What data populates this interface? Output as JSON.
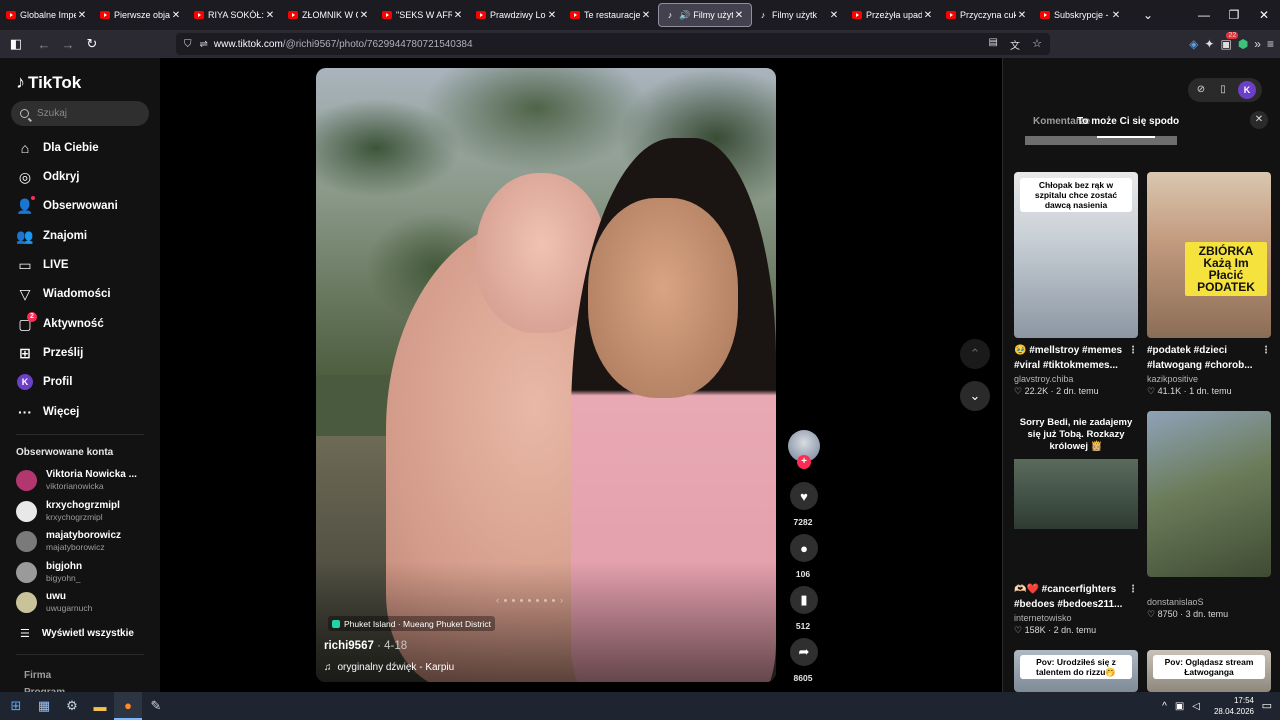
{
  "browser": {
    "tabs": [
      {
        "title": "Globalne Imperi",
        "icon": "youtube-icon"
      },
      {
        "title": "Pierwsze objawy",
        "icon": "youtube-icon"
      },
      {
        "title": "RIYA SOKÓŁ: wy",
        "icon": "youtube-icon"
      },
      {
        "title": "ZŁOMNIK W CH",
        "icon": "youtube-icon"
      },
      {
        "title": "\"SEKS W AFRYC",
        "icon": "youtube-icon"
      },
      {
        "title": "Prawdziwy Lom",
        "icon": "youtube-icon"
      },
      {
        "title": "Te restauracje p",
        "icon": "youtube-icon"
      },
      {
        "title": "Filmy użyt",
        "icon": "tiktok-icon",
        "active": true
      },
      {
        "title": "Filmy użytk",
        "icon": "tiktok-icon"
      },
      {
        "title": "Przeżyła upadek",
        "icon": "youtube-icon"
      },
      {
        "title": "Przyczyna cukrz",
        "icon": "youtube-icon"
      },
      {
        "title": "Subskrypcje - Yo",
        "icon": "youtube-icon"
      }
    ],
    "url_host": "www.tiktok.com",
    "url_path": "/@richi9567/photo/7629944780721540384",
    "extension_badge": "22"
  },
  "sidebar": {
    "logo": "TikTok",
    "search_placeholder": "Szukaj",
    "nav": [
      {
        "label": "Dla Ciebie",
        "icon": "home-icon"
      },
      {
        "label": "Odkryj",
        "icon": "compass-icon"
      },
      {
        "label": "Obserwowani",
        "icon": "following-icon"
      },
      {
        "label": "Znajomi",
        "icon": "friends-icon"
      },
      {
        "label": "LIVE",
        "icon": "live-icon"
      },
      {
        "label": "Wiadomości",
        "icon": "messages-icon"
      },
      {
        "label": "Aktywność",
        "icon": "activity-icon",
        "badge": "2"
      },
      {
        "label": "Prześlij",
        "icon": "upload-icon"
      },
      {
        "label": "Profil",
        "icon": "profile-avatar",
        "avatar_letter": "K"
      },
      {
        "label": "Więcej",
        "icon": "more-icon"
      }
    ],
    "followed_title": "Obserwowane konta",
    "accounts": [
      {
        "name": "Viktoria Nowicka ...",
        "username": "viktorianowicka",
        "color": "#b2376e"
      },
      {
        "name": "krxychogrzmipl",
        "username": "krxychogrzmipl",
        "color": "#e8e8e8"
      },
      {
        "name": "majatyborowicz",
        "username": "majatyborowicz",
        "color": "#7a7a7a"
      },
      {
        "name": "bigjohn",
        "username": "bigyohn_",
        "color": "#9a9a9a"
      },
      {
        "name": "uwu",
        "username": "uwugarnuch",
        "color": "#c9c39a"
      }
    ],
    "see_all": "Wyświetl wszystkie",
    "footer": [
      "Firma",
      "Program"
    ]
  },
  "post": {
    "location": "Phuket Island · Mueang Phuket District",
    "author": "richi9567",
    "date": " · 4-18",
    "sound": "oryginalny dźwięk - Karpiu",
    "likes": "7282",
    "comments": "106",
    "saves": "512",
    "shares": "8605"
  },
  "right_panel": {
    "tab_comments": "Komentarze",
    "tab_suggested": "To może Ci się spodo",
    "cards": [
      {
        "overlay": "Chłopak bez rąk w szpitalu chce zostać dawcą nasienia",
        "caption": "🥹 #mellstroy #memes #viral #tiktokmemes...",
        "author": "glavstroy.chiba",
        "likes": "22.2K",
        "age": "2 dn. temu"
      },
      {
        "overlay": "ZBIÓRKA Każą Im Płacić PODATEK",
        "caption": "#podatek #dzieci #latwogang #chorob...",
        "author": "kazikpositive",
        "likes": "41.1K",
        "age": "1 dn. temu"
      },
      {
        "overlay": "Sorry Bedi, nie zadajemy się już Tobą. Rozkazy królowej 👸🏼",
        "caption": "🫶🏻❤️ #cancerfighters #bedoes #bedoes211...",
        "author": "internetowisko",
        "likes": "158K",
        "age": "2 dn. temu"
      },
      {
        "overlay": "",
        "caption": "",
        "author": "donstanislaoS",
        "likes": "8750",
        "age": "3 dn. temu"
      },
      {
        "overlay": "Pov: Urodziłeś się z talentem do rizzu🤭"
      },
      {
        "overlay": "Pov: Oglądasz stream Łatwoganga"
      }
    ]
  },
  "taskbar": {
    "time": "17:54",
    "date": "28.04.2026"
  }
}
